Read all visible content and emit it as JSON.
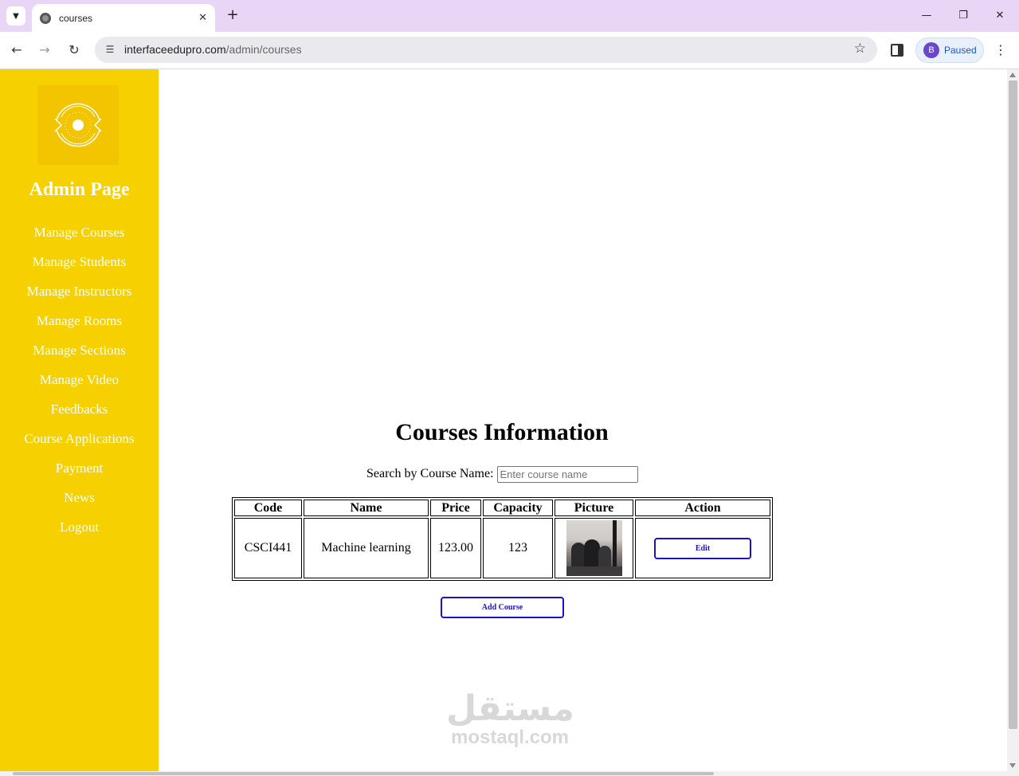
{
  "browser": {
    "tab_title": "courses",
    "url_domain": "interfaceedupro.com",
    "url_path": "/admin/courses",
    "profile_initial": "B",
    "profile_status": "Paused",
    "icons": [
      "tab-search-icon",
      "globe-icon",
      "close-icon",
      "new-tab-icon",
      "minimize-icon",
      "restore-icon",
      "window-close-icon",
      "back-icon",
      "forward-icon",
      "reload-icon",
      "site-settings-icon",
      "bookmark-star-icon",
      "side-panel-icon",
      "menu-icon"
    ]
  },
  "sidebar": {
    "title": "Admin Page",
    "logo_icon": "admin-logo-icon",
    "items": [
      {
        "label": "Manage Courses"
      },
      {
        "label": "Manage Students"
      },
      {
        "label": "Manage Instructors"
      },
      {
        "label": "Manage Rooms"
      },
      {
        "label": "Manage Sections"
      },
      {
        "label": "Manage Video"
      },
      {
        "label": "Feedbacks"
      },
      {
        "label": "Course Applications"
      },
      {
        "label": "Payment"
      },
      {
        "label": "News"
      },
      {
        "label": "Logout"
      }
    ],
    "background_color": "#f7d000"
  },
  "main": {
    "heading": "Courses Information",
    "search": {
      "label": "Search by Course Name:",
      "placeholder": "Enter course name",
      "value": ""
    },
    "table": {
      "headers": [
        "Code",
        "Name",
        "Price",
        "Capacity",
        "Picture",
        "Action"
      ],
      "rows": [
        {
          "code": "CSCI441",
          "name": "Machine learning",
          "price": "123.00",
          "capacity": "123",
          "picture": "course-thumbnail",
          "action": "Edit"
        }
      ]
    },
    "add_button": "Add Course",
    "accent_color": "#1a12c4"
  },
  "watermark": {
    "arabic": "مستقل",
    "latin": "mostaql.com"
  }
}
